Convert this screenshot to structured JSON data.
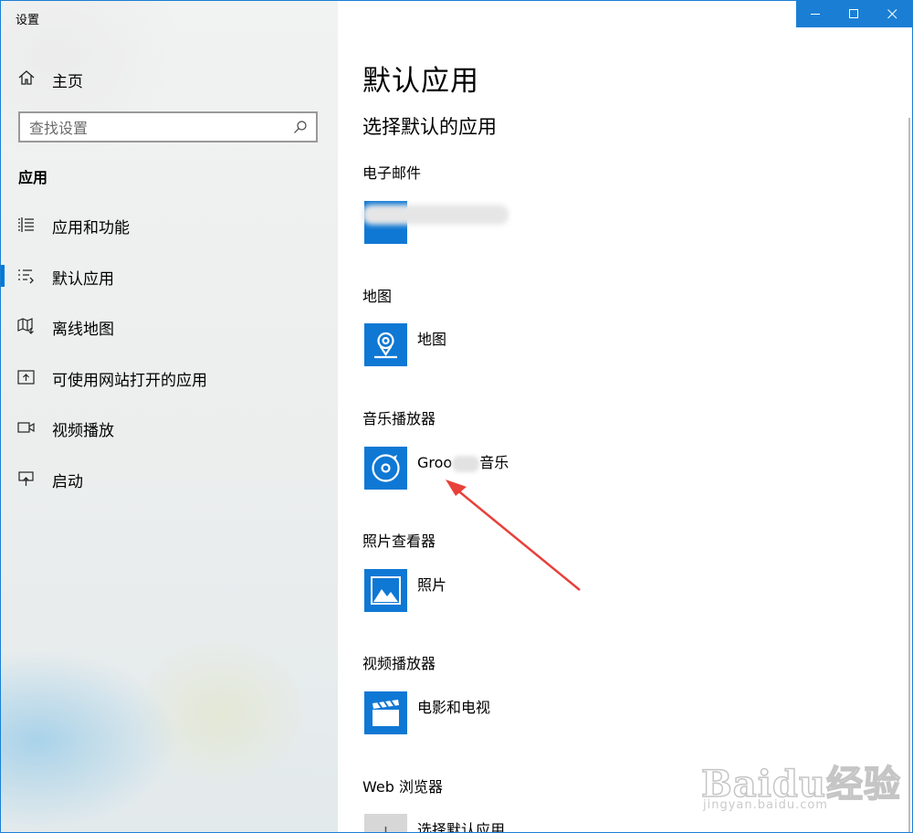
{
  "window": {
    "title": "设置",
    "controls": [
      "minimize-icon",
      "maximize-icon",
      "close-icon"
    ],
    "accent_color": "#0078d7"
  },
  "sidebar": {
    "home_label": "主页",
    "search_placeholder": "查找设置",
    "section_title": "应用",
    "items": [
      {
        "label": "应用和功能",
        "icon": "list-icon",
        "selected": false
      },
      {
        "label": "默认应用",
        "icon": "default-apps-icon",
        "selected": true
      },
      {
        "label": "离线地图",
        "icon": "offline-map-icon",
        "selected": false
      },
      {
        "label": "可使用网站打开的应用",
        "icon": "open-with-website-icon",
        "selected": false
      },
      {
        "label": "视频播放",
        "icon": "video-camera-icon",
        "selected": false
      },
      {
        "label": "启动",
        "icon": "startup-icon",
        "selected": false
      }
    ]
  },
  "main": {
    "page_title": "默认应用",
    "subtitle": "选择默认的应用",
    "categories": [
      {
        "label": "电子邮件",
        "app": "",
        "icon": "mail-app-icon"
      },
      {
        "label": "地图",
        "app": "地图",
        "icon": "maps-app-icon"
      },
      {
        "label": "音乐播放器",
        "app_prefix": "Groo",
        "app_suffix": "音乐",
        "icon": "groove-music-icon"
      },
      {
        "label": "照片查看器",
        "app": "照片",
        "icon": "photos-app-icon"
      },
      {
        "label": "视频播放器",
        "app": "电影和电视",
        "icon": "movies-tv-icon"
      },
      {
        "label": "Web 浏览器",
        "app": "选择默认应用",
        "icon": "plus-icon"
      }
    ]
  },
  "watermark": {
    "brand": "Baidu经验",
    "url": "jingyan.baidu.com"
  }
}
